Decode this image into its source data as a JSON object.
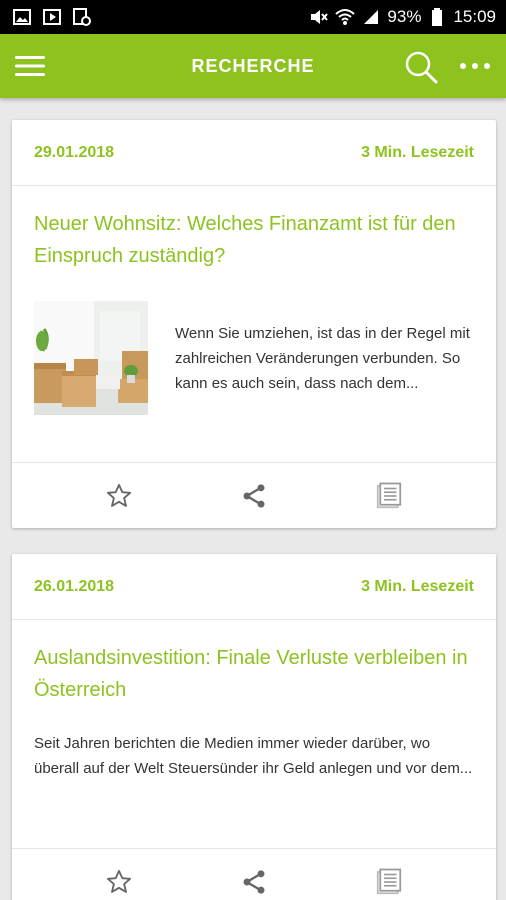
{
  "status_bar": {
    "battery": "93%",
    "time": "15:09",
    "icons_left": [
      "gallery-icon",
      "play-store-icon",
      "notification-icon"
    ],
    "icons_right": [
      "mute-icon",
      "wifi-icon",
      "signal-icon",
      "battery-icon"
    ]
  },
  "app_bar": {
    "title": "RECHERCHE",
    "color": "#8dc21f"
  },
  "articles": [
    {
      "date": "29.01.2018",
      "reading_time": "3 Min. Lesezeit",
      "title": "Neuer Wohnsitz: Welches Finanzamt ist für den Einspruch zuständig?",
      "excerpt": "Wenn Sie umziehen, ist das in der Regel mit zahlreichen Veränderungen verbunden. So kann es auch sein, dass nach dem...",
      "has_image": true,
      "actions": [
        "star-icon",
        "share-icon",
        "article-icon"
      ]
    },
    {
      "date": "26.01.2018",
      "reading_time": "3 Min. Lesezeit",
      "title": "Auslandsinvestition: Finale Verluste verbleiben in Österreich",
      "excerpt": "Seit Jahren berichten die Medien immer wieder darüber, wo überall auf der Welt Steuersünder ihr Geld anlegen und vor dem...",
      "has_image": false,
      "actions": [
        "star-icon",
        "share-icon",
        "article-icon"
      ]
    }
  ]
}
